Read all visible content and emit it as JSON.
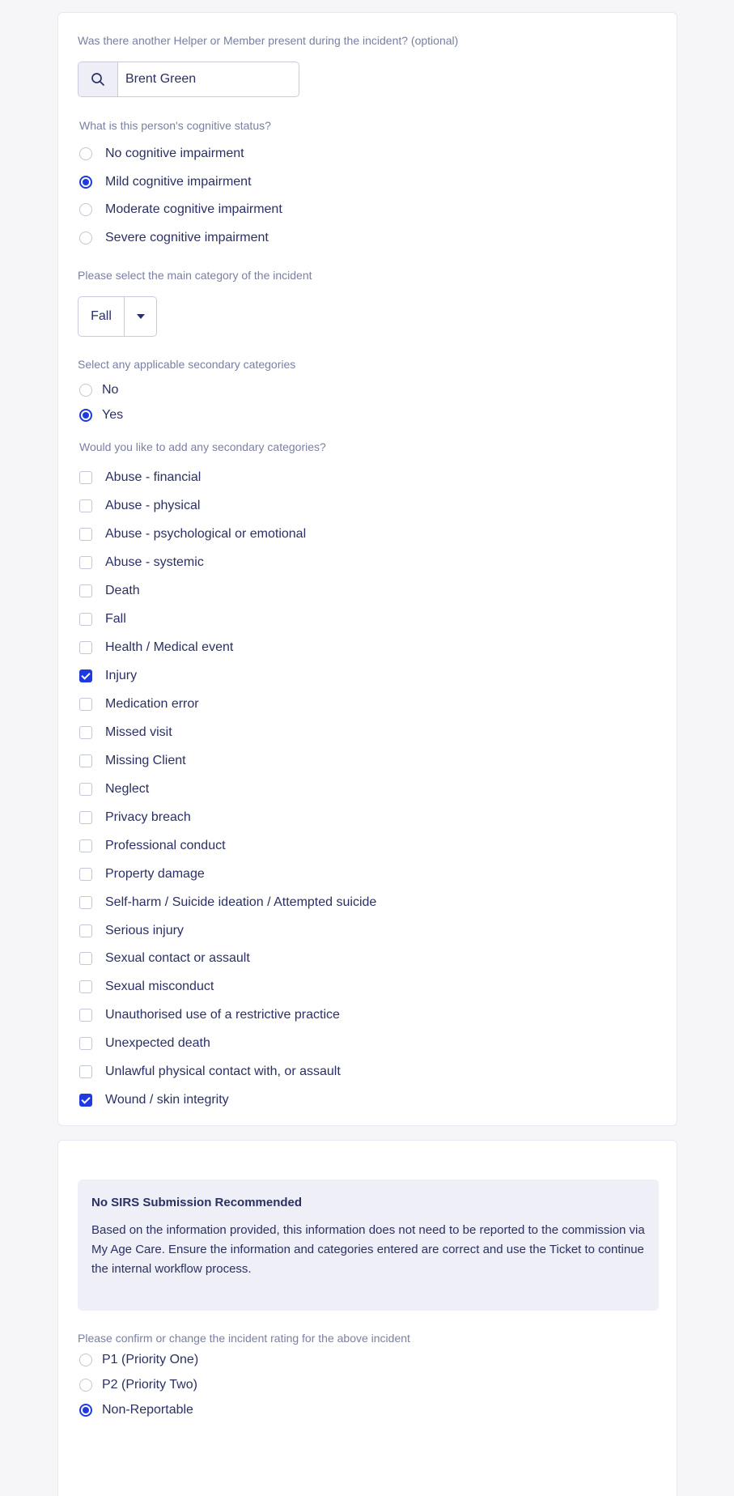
{
  "helper_section": {
    "label": "Was there another Helper or Member present during the incident? (optional)",
    "value": "Brent Green",
    "icon": "search-icon"
  },
  "cognitive": {
    "label": "What is this person's cognitive status?",
    "options": [
      {
        "label": "No cognitive impairment",
        "selected": false
      },
      {
        "label": "Mild cognitive impairment",
        "selected": true
      },
      {
        "label": "Moderate cognitive impairment",
        "selected": false
      },
      {
        "label": "Severe cognitive impairment",
        "selected": false
      }
    ]
  },
  "main_category": {
    "label": "Please select the main category of the incident",
    "value": "Fall"
  },
  "secondary_toggle": {
    "label": "Select any applicable secondary categories",
    "options": [
      {
        "label": "No",
        "selected": false
      },
      {
        "label": "Yes",
        "selected": true
      }
    ]
  },
  "secondary_categories": {
    "label": "Would you like to add any secondary categories?",
    "items": [
      {
        "label": "Abuse - financial",
        "checked": false
      },
      {
        "label": "Abuse - physical",
        "checked": false
      },
      {
        "label": "Abuse - psychological or emotional",
        "checked": false
      },
      {
        "label": "Abuse - systemic",
        "checked": false
      },
      {
        "label": "Death",
        "checked": false
      },
      {
        "label": "Fall",
        "checked": false
      },
      {
        "label": "Health / Medical event",
        "checked": false
      },
      {
        "label": "Injury",
        "checked": true
      },
      {
        "label": "Medication error",
        "checked": false
      },
      {
        "label": "Missed visit",
        "checked": false
      },
      {
        "label": "Missing Client",
        "checked": false
      },
      {
        "label": "Neglect",
        "checked": false
      },
      {
        "label": "Privacy breach",
        "checked": false
      },
      {
        "label": "Professional conduct",
        "checked": false
      },
      {
        "label": "Property damage",
        "checked": false
      },
      {
        "label": "Self-harm / Suicide ideation / Attempted suicide",
        "checked": false
      },
      {
        "label": "Serious injury",
        "checked": false
      },
      {
        "label": "Sexual contact or assault",
        "checked": false
      },
      {
        "label": "Sexual misconduct",
        "checked": false
      },
      {
        "label": "Unauthorised use of a restrictive practice",
        "checked": false
      },
      {
        "label": "Unexpected death",
        "checked": false
      },
      {
        "label": "Unlawful physical contact with, or assault",
        "checked": false
      },
      {
        "label": "Wound / skin integrity",
        "checked": true
      }
    ]
  },
  "notice": {
    "title": "No SIRS Submission Recommended",
    "body": "Based on the information provided, this information does not need to be reported to the commission via My Age Care. Ensure the information and categories entered are correct and use the Ticket to continue the internal workflow process."
  },
  "rating": {
    "label": "Please confirm or change the incident rating for the above incident",
    "options": [
      {
        "label": "P1 (Priority One)",
        "selected": false
      },
      {
        "label": "P2 (Priority Two)",
        "selected": false
      },
      {
        "label": "Non-Reportable",
        "selected": true
      }
    ]
  },
  "colors": {
    "accent": "#1f3be0",
    "text": "#2b3064",
    "muted": "#7a7fa3",
    "background": "#f6f6f9"
  }
}
